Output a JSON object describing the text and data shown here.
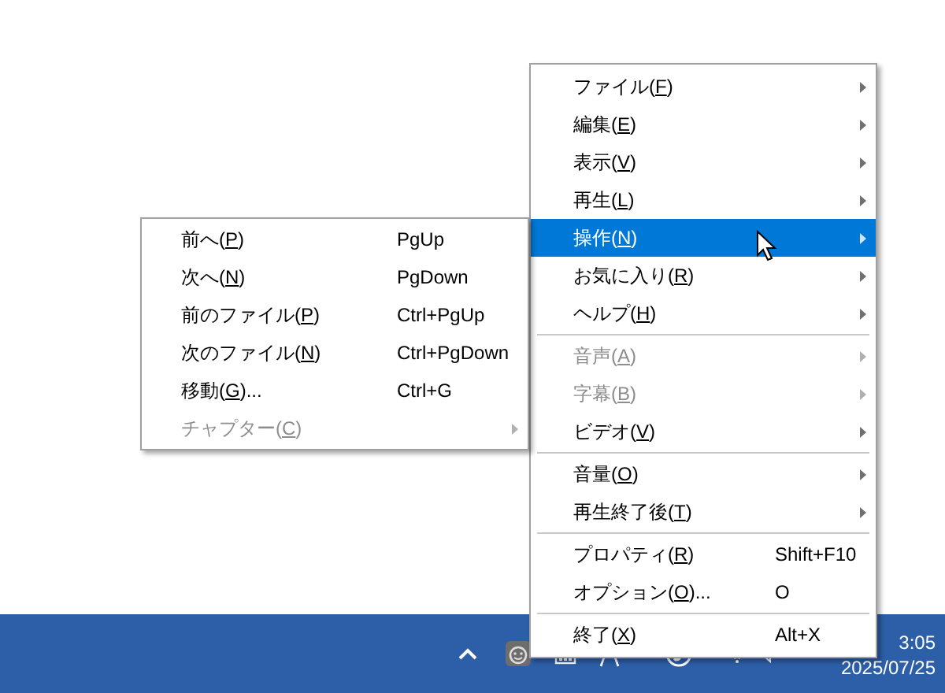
{
  "context_menu": {
    "items": [
      {
        "kind": "submenu",
        "text_before": "ファイル(",
        "mnemonic": "F",
        "text_after": ")",
        "disabled": false,
        "selected": false
      },
      {
        "kind": "submenu",
        "text_before": "編集(",
        "mnemonic": "E",
        "text_after": ")",
        "disabled": false,
        "selected": false
      },
      {
        "kind": "submenu",
        "text_before": "表示(",
        "mnemonic": "V",
        "text_after": ")",
        "disabled": false,
        "selected": false
      },
      {
        "kind": "submenu",
        "text_before": "再生(",
        "mnemonic": "L",
        "text_after": ")",
        "disabled": false,
        "selected": false
      },
      {
        "kind": "submenu",
        "text_before": "操作(",
        "mnemonic": "N",
        "text_after": ")",
        "disabled": false,
        "selected": true
      },
      {
        "kind": "submenu",
        "text_before": "お気に入り(",
        "mnemonic": "R",
        "text_after": ")",
        "disabled": false,
        "selected": false
      },
      {
        "kind": "submenu",
        "text_before": "ヘルプ(",
        "mnemonic": "H",
        "text_after": ")",
        "disabled": false,
        "selected": false
      },
      {
        "kind": "separator"
      },
      {
        "kind": "submenu",
        "text_before": "音声(",
        "mnemonic": "A",
        "text_after": ")",
        "disabled": true,
        "selected": false
      },
      {
        "kind": "submenu",
        "text_before": "字幕(",
        "mnemonic": "B",
        "text_after": ")",
        "disabled": true,
        "selected": false
      },
      {
        "kind": "submenu",
        "text_before": "ビデオ(",
        "mnemonic": "V",
        "text_after": ")",
        "disabled": false,
        "selected": false
      },
      {
        "kind": "separator"
      },
      {
        "kind": "submenu",
        "text_before": "音量(",
        "mnemonic": "O",
        "text_after": ")",
        "disabled": false,
        "selected": false
      },
      {
        "kind": "submenu",
        "text_before": "再生終了後(",
        "mnemonic": "T",
        "text_after": ")",
        "disabled": false,
        "selected": false
      },
      {
        "kind": "separator"
      },
      {
        "kind": "command",
        "text_before": "プロパティ(",
        "mnemonic": "R",
        "text_after": ")",
        "shortcut": "Shift+F10",
        "disabled": false,
        "selected": false
      },
      {
        "kind": "command",
        "text_before": "オプション(",
        "mnemonic": "O",
        "text_after": ")...",
        "shortcut": "O",
        "disabled": false,
        "selected": false
      },
      {
        "kind": "separator"
      },
      {
        "kind": "command",
        "text_before": "終了(",
        "mnemonic": "X",
        "text_after": ")",
        "shortcut": "Alt+X",
        "disabled": false,
        "selected": false
      }
    ]
  },
  "submenu": {
    "items": [
      {
        "kind": "command",
        "text_before": "前へ(",
        "mnemonic": "P",
        "text_after": ")",
        "shortcut": "PgUp",
        "disabled": false,
        "selected": false
      },
      {
        "kind": "command",
        "text_before": "次へ(",
        "mnemonic": "N",
        "text_after": ")",
        "shortcut": "PgDown",
        "disabled": false,
        "selected": false
      },
      {
        "kind": "command",
        "text_before": "前のファイル(",
        "mnemonic": "P",
        "text_after": ")",
        "shortcut": "Ctrl+PgUp",
        "disabled": false,
        "selected": false
      },
      {
        "kind": "command",
        "text_before": "次のファイル(",
        "mnemonic": "N",
        "text_after": ")",
        "shortcut": "Ctrl+PgDown",
        "disabled": false,
        "selected": false
      },
      {
        "kind": "command",
        "text_before": "移動(",
        "mnemonic": "G",
        "text_after": ")...",
        "shortcut": "Ctrl+G",
        "disabled": false,
        "selected": false
      },
      {
        "kind": "submenu",
        "text_before": "チャプター(",
        "mnemonic": "C",
        "text_after": ")",
        "disabled": true,
        "selected": false
      }
    ]
  },
  "taskbar": {
    "clock_time": "3:05",
    "clock_date": "2025/07/25"
  }
}
